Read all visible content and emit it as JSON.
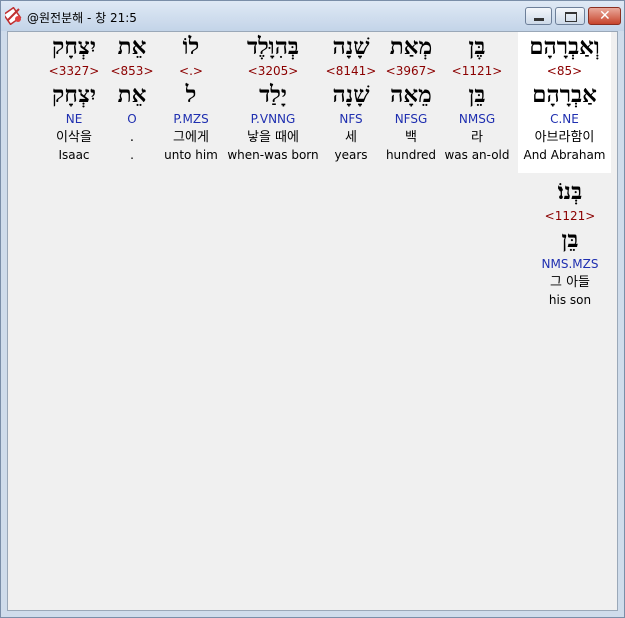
{
  "window": {
    "title": "@원전분해 - 창 21:5",
    "buttons": {
      "minimize": "minimize",
      "maximize": "maximize",
      "close": "✕"
    }
  },
  "words": [
    {
      "hebrew": "וְאַבְרָהָם",
      "strong": "<85>",
      "lemma": "אַבְרָהָם",
      "morph": "C.NE",
      "korean": "아브라함이",
      "english": "And Abraham",
      "selected": true
    },
    {
      "hebrew": "בֶּן",
      "strong": "<1121>",
      "lemma": "בֵּן",
      "morph": "NMSG",
      "korean": "라",
      "english": "was an-old"
    },
    {
      "hebrew": "מְאַת",
      "strong": "<3967>",
      "lemma": "מֵאָה",
      "morph": "NFSG",
      "korean": "백",
      "english": "hundred"
    },
    {
      "hebrew": "שָׁנָה",
      "strong": "<8141>",
      "lemma": "שָׁנָה",
      "morph": "NFS",
      "korean": "세",
      "english": "years"
    },
    {
      "hebrew": "בְּהִוָּלֶד",
      "strong": "<3205>",
      "lemma": "יָלַד",
      "morph": "P.VNNG",
      "korean": "낳을 때에",
      "english": "when-was born"
    },
    {
      "hebrew": "לוֹ",
      "strong": "<.>",
      "lemma": "ל",
      "morph": "P.MZS",
      "korean": "그에게",
      "english": "unto him"
    },
    {
      "hebrew": "אֵת",
      "strong": "<853>",
      "lemma": "אֵת",
      "morph": "O",
      "korean": ".",
      "english": "."
    },
    {
      "hebrew": "יִצְחָק",
      "strong": "<3327>",
      "lemma": "יִצְחָק",
      "morph": "NE",
      "korean": "이삭을",
      "english": "Isaac"
    },
    {
      "hebrew": "בְּנוֹ׃",
      "strong": "<1121>",
      "lemma": "בֵּן",
      "morph": "NMS.MZS",
      "korean": "그 아들",
      "english": "his son"
    }
  ]
}
